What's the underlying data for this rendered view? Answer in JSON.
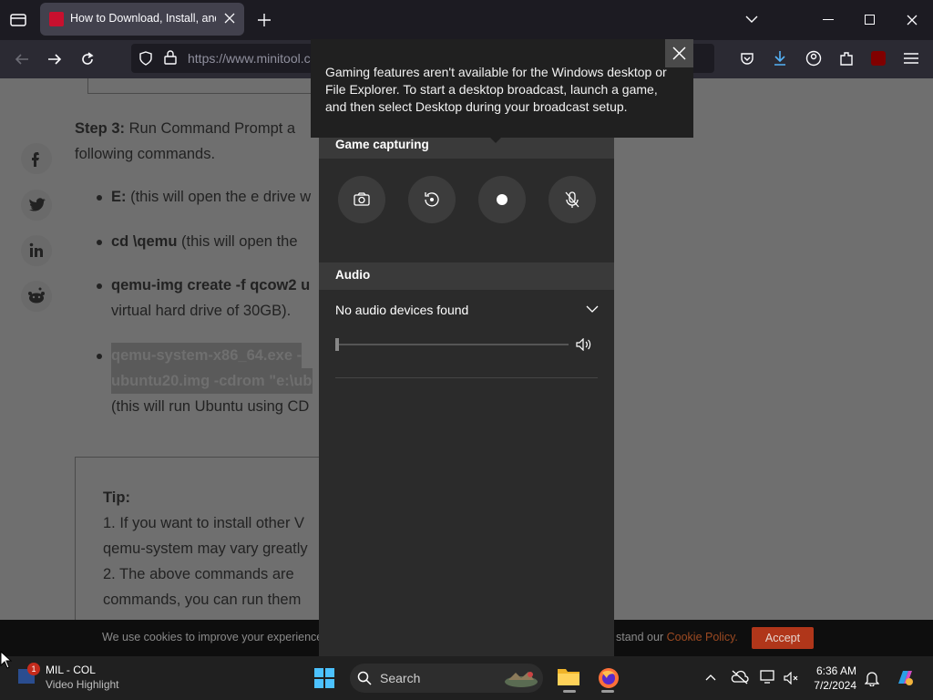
{
  "browser": {
    "tab_title": "How to Download, Install, and",
    "url": "https://www.minitool.c"
  },
  "article": {
    "step3_bold": "Step 3:",
    "step3_text": " Run Command Prompt a",
    "step3_line2": "following commands.",
    "b1_bold": "E:",
    "b1_text": " (this will open the e drive w",
    "b2_bold": "cd \\qemu",
    "b2_text": " (this will open the",
    "b3_bold": "qemu-img create -f qcow2 u",
    "b3_line2": "virtual hard drive of 30GB).",
    "b4_line1": "qemu-system-x86_64.exe -",
    "b4_line2": "ubuntu20.img -cdrom \"e:\\ub",
    "b4_line3": "(this will run Ubuntu using CD",
    "tip_title": "Tip:",
    "tip_1a": "1. If you want to install other V",
    "tip_1b": "qemu-system may vary greatly",
    "tip_2a": "2. The above commands are",
    "tip_2b": "commands, you can run them"
  },
  "cookie": {
    "text": "We use cookies to improve your experience.",
    "policy_pre": "stand our",
    "policy_link": "Cookie Policy.",
    "accept": "Accept"
  },
  "gamebar": {
    "capturing_title": "Game capturing",
    "audio_title": "Audio",
    "audio_device": "No audio devices found"
  },
  "tooltip": {
    "text": "Gaming features aren't available for the Windows desktop or File Explorer. To start a desktop broadcast, launch a game, and then select Desktop during your broadcast setup."
  },
  "taskbar": {
    "search_placeholder": "Search",
    "notif_title": "MIL - COL",
    "notif_sub": "Video Highlight",
    "notif_badge": "1",
    "time": "6:36 AM",
    "date": "7/2/2024"
  }
}
